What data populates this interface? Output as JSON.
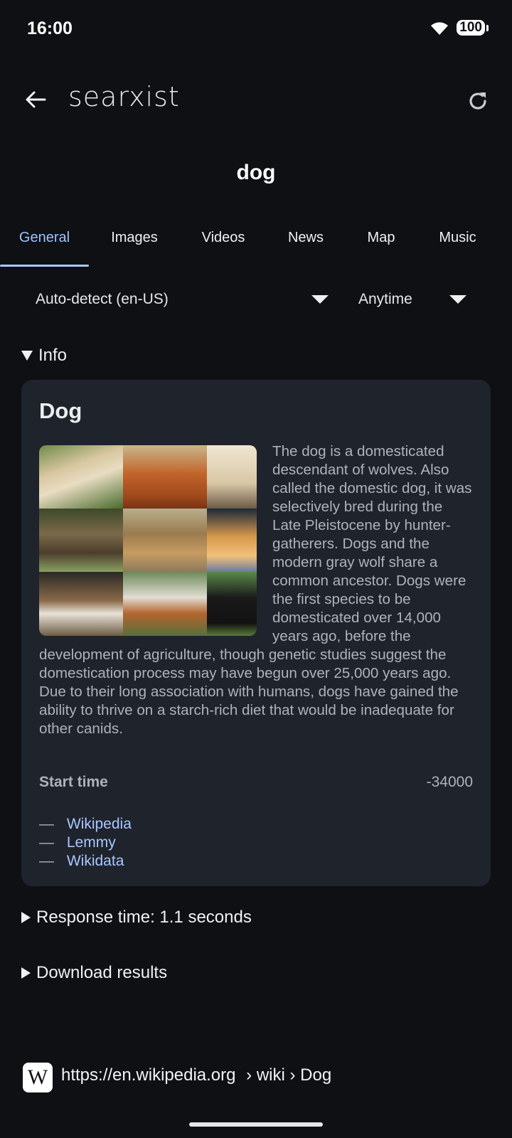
{
  "status_bar": {
    "time": "16:00",
    "battery": "100"
  },
  "app_bar": {
    "title": "searxist"
  },
  "search": {
    "query": "dog"
  },
  "tabs": [
    {
      "label": "General",
      "active": true
    },
    {
      "label": "Images",
      "active": false
    },
    {
      "label": "Videos",
      "active": false
    },
    {
      "label": "News",
      "active": false
    },
    {
      "label": "Map",
      "active": false
    },
    {
      "label": "Music",
      "active": false
    }
  ],
  "filters": {
    "language": "Auto-detect (en-US)",
    "time_range": "Anytime"
  },
  "info_section": {
    "toggle_label": "Info",
    "card": {
      "title": "Dog",
      "description": "The dog is a domesticated descendant of wolves. Also called the domestic dog, it was selectively bred during the Late Pleistocene by hunter-gatherers. Dogs and the modern gray wolf share a common ancestor. Dogs were the first species to be domesticated over 14,000 years ago, before the development of agriculture, though genetic studies suggest the domestication process may have begun over 25,000 years ago. Due to their long association with humans, dogs have gained the ability to thrive on a starch-rich diet that would be inadequate for other canids.",
      "attribute_label": "Start time",
      "attribute_value": "-34000",
      "links": [
        "Wikipedia",
        "Lemmy",
        "Wikidata"
      ]
    }
  },
  "response_time": {
    "label": "Response time: 1.1 seconds"
  },
  "download": {
    "label": "Download results"
  },
  "first_result": {
    "favicon_letter": "W",
    "url": "https://en.wikipedia.org",
    "path": "› wiki › Dog"
  },
  "colors": {
    "accent": "#a9c7ff",
    "background": "#0e1014",
    "card": "#1f232c"
  }
}
